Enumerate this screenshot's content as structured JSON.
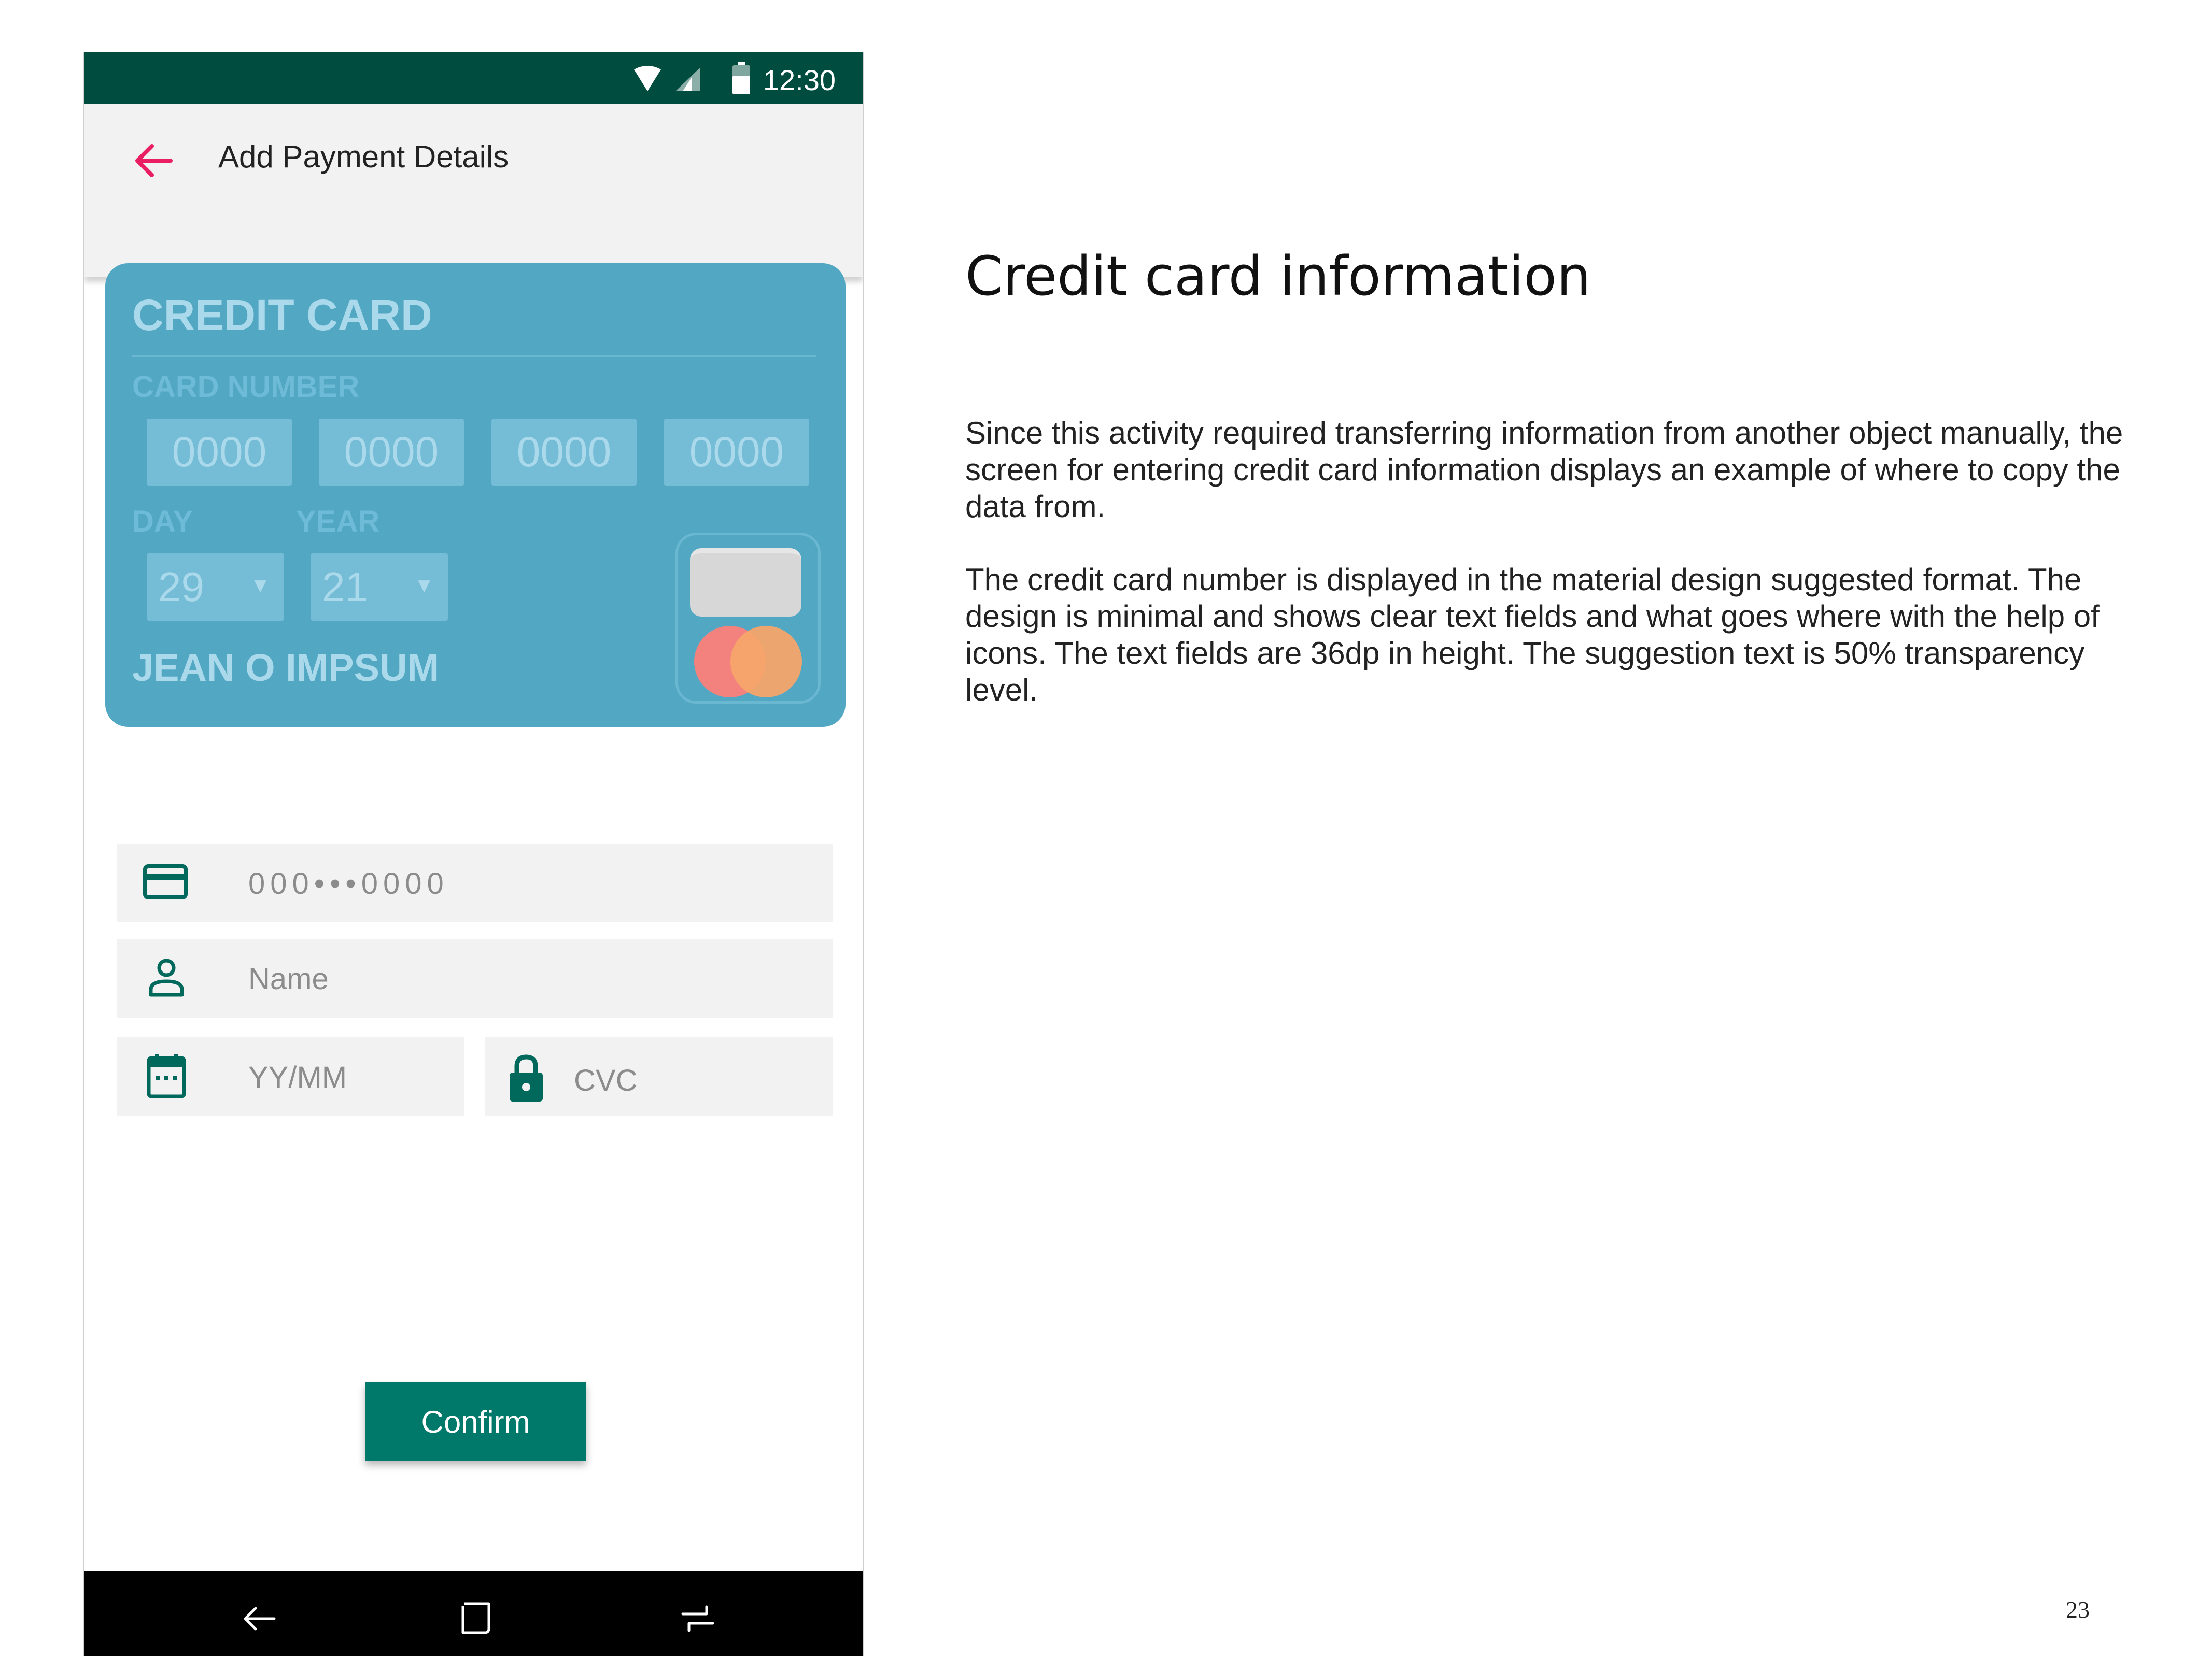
{
  "status_bar": {
    "time": "12:30"
  },
  "app_bar": {
    "title": "Add Payment Details"
  },
  "card_illustration": {
    "title": "CREDIT CARD",
    "card_number_label": "CARD NUMBER",
    "number_groups": [
      "0000",
      "0000",
      "0000",
      "0000"
    ],
    "day_label": "DAY",
    "year_label": "YEAR",
    "day_value": "29",
    "year_value": "21",
    "holder_name": "JEAN O IMPSUM"
  },
  "form": {
    "card_number_placeholder": "000•••0000",
    "name_placeholder": "Name",
    "expiry_placeholder": "YY/MM",
    "cvc_placeholder": "CVC"
  },
  "confirm_label": "Confirm",
  "doc": {
    "heading": "Credit card information",
    "paragraph_1": "Since this activity required transferring information from another object manually, the screen for entering credit card information displays an example of where to copy the data from.",
    "paragraph_2": "The credit card number is displayed in the material design suggested format. The design is minimal and shows clear text fields and what goes where with the help of icons. The text fields are 36dp in height. The suggestion text is 50% transparency level.",
    "page_number": "23"
  },
  "colors": {
    "status_bar": "#004d40",
    "accent_back": "#e91e63",
    "card_bg": "#52a7c3",
    "icon_teal": "#00695c",
    "button": "#00796b"
  },
  "icons": [
    "wifi-icon",
    "signal-icon",
    "battery-icon",
    "back-arrow-icon",
    "credit-card-icon",
    "person-icon",
    "calendar-icon",
    "lock-icon",
    "nav-back-icon",
    "nav-home-icon",
    "nav-recents-icon"
  ]
}
